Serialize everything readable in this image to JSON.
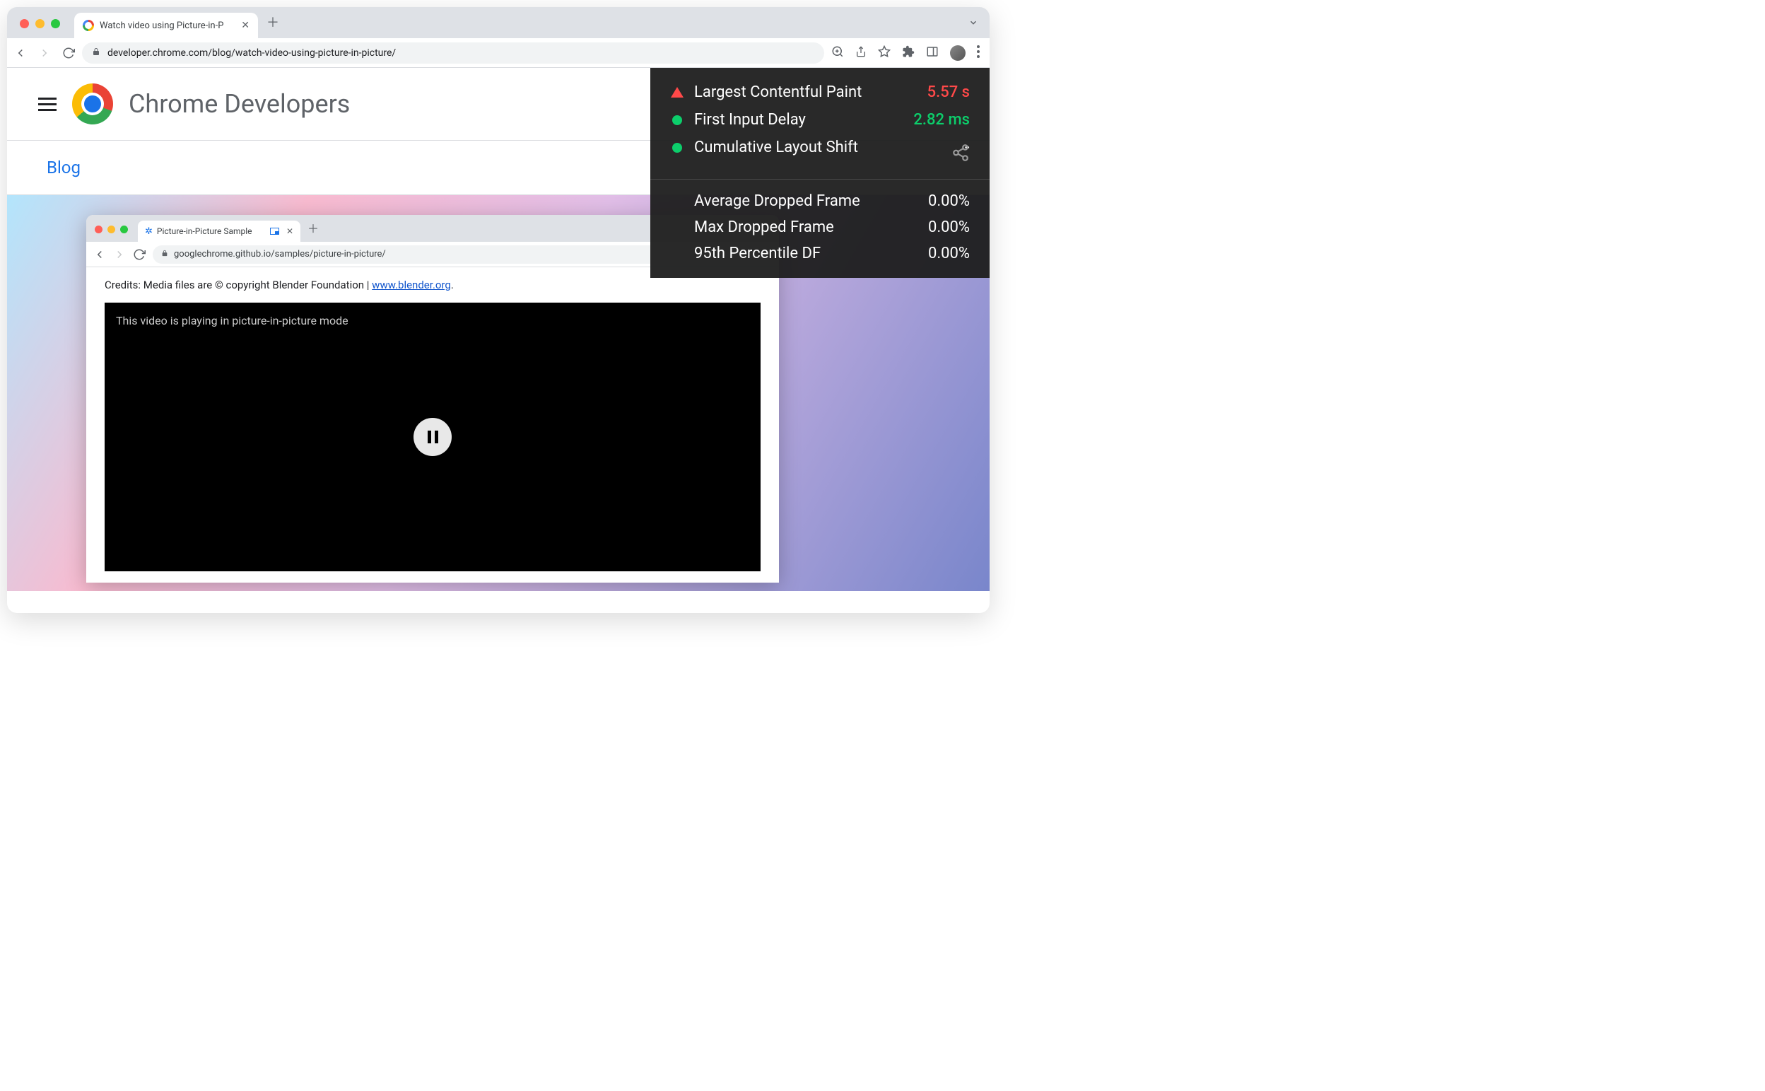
{
  "browser": {
    "tab_title": "Watch video using Picture-in-P",
    "url": "developer.chrome.com/blog/watch-video-using-picture-in-picture/"
  },
  "page": {
    "site_title": "Chrome Developers",
    "blog_link": "Blog"
  },
  "inner": {
    "tab_title": "Picture-in-Picture Sample",
    "url": "googlechrome.github.io/samples/picture-in-picture/",
    "credits_prefix": "Credits: Media files are © copyright Blender Foundation | ",
    "credits_link": "www.blender.org",
    "credits_suffix": ".",
    "video_caption": "This video is playing in picture-in-picture mode"
  },
  "vitals": {
    "top": [
      {
        "label": "Largest Contentful Paint",
        "value": "5.57 s",
        "status": "red"
      },
      {
        "label": "First Input Delay",
        "value": "2.82 ms",
        "status": "green"
      },
      {
        "label": "Cumulative Layout Shift",
        "value": "-",
        "status": "green"
      }
    ],
    "bottom": [
      {
        "label": "Average Dropped Frame",
        "value": "0.00%"
      },
      {
        "label": "Max Dropped Frame",
        "value": "0.00%"
      },
      {
        "label": "95th Percentile DF",
        "value": "0.00%"
      }
    ]
  }
}
